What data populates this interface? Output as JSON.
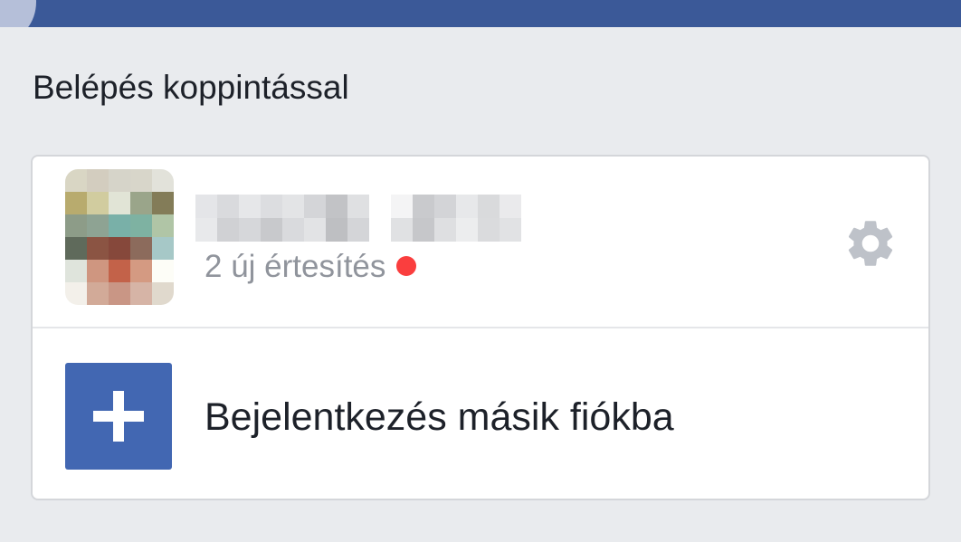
{
  "header": {
    "bar_color": "#3b5998"
  },
  "section_title": "Belépés koppintással",
  "account": {
    "name": "",
    "name_obscured": true,
    "notification_text": "2 új értesítés",
    "notification_dot_color": "#fa3e3e",
    "avatar_obscured": true,
    "settings_icon": "gear-icon"
  },
  "add_account": {
    "label": "Bejelentkezés másik fiókba",
    "icon": "plus-icon",
    "icon_bg_color": "#4267b2"
  }
}
